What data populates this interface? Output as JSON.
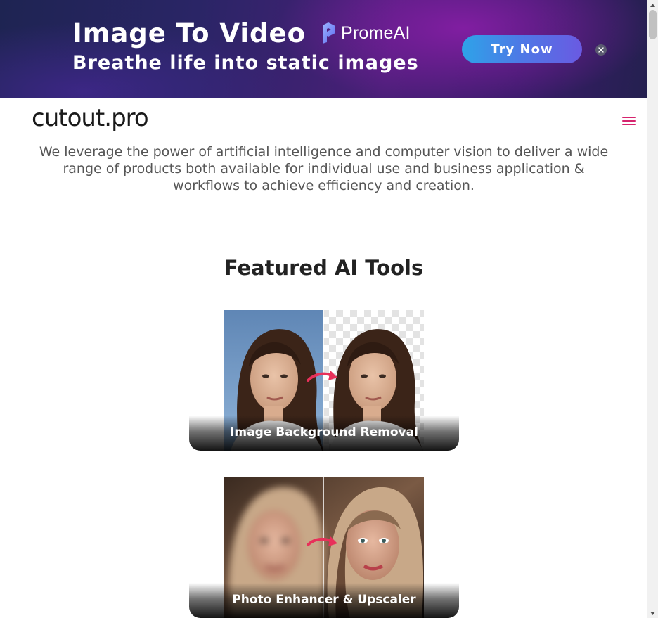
{
  "banner": {
    "title": "Image To Video",
    "subtitle": "Breathe life into static images",
    "brand": "PromeAI",
    "cta_label": "Try Now",
    "close_icon": "close-icon",
    "colors": {
      "cta_start": "#2ea3e8",
      "cta_end": "#6a5ae2"
    }
  },
  "header": {
    "logo": "cutout.pro",
    "menu_icon": "hamburger-menu-icon",
    "menu_color": "#d6246e"
  },
  "intro": {
    "text": "We leverage the power of artificial intelligence and computer vision to deliver a wide range of products both available for individual use and business application & workflows to achieve efficiency and creation."
  },
  "featured": {
    "title": "Featured AI Tools",
    "tools": [
      {
        "label": "Image Background Removal",
        "image": "before-after-background-removal"
      },
      {
        "label": "Photo Enhancer & Upscaler",
        "image": "before-after-photo-enhancer"
      }
    ]
  }
}
